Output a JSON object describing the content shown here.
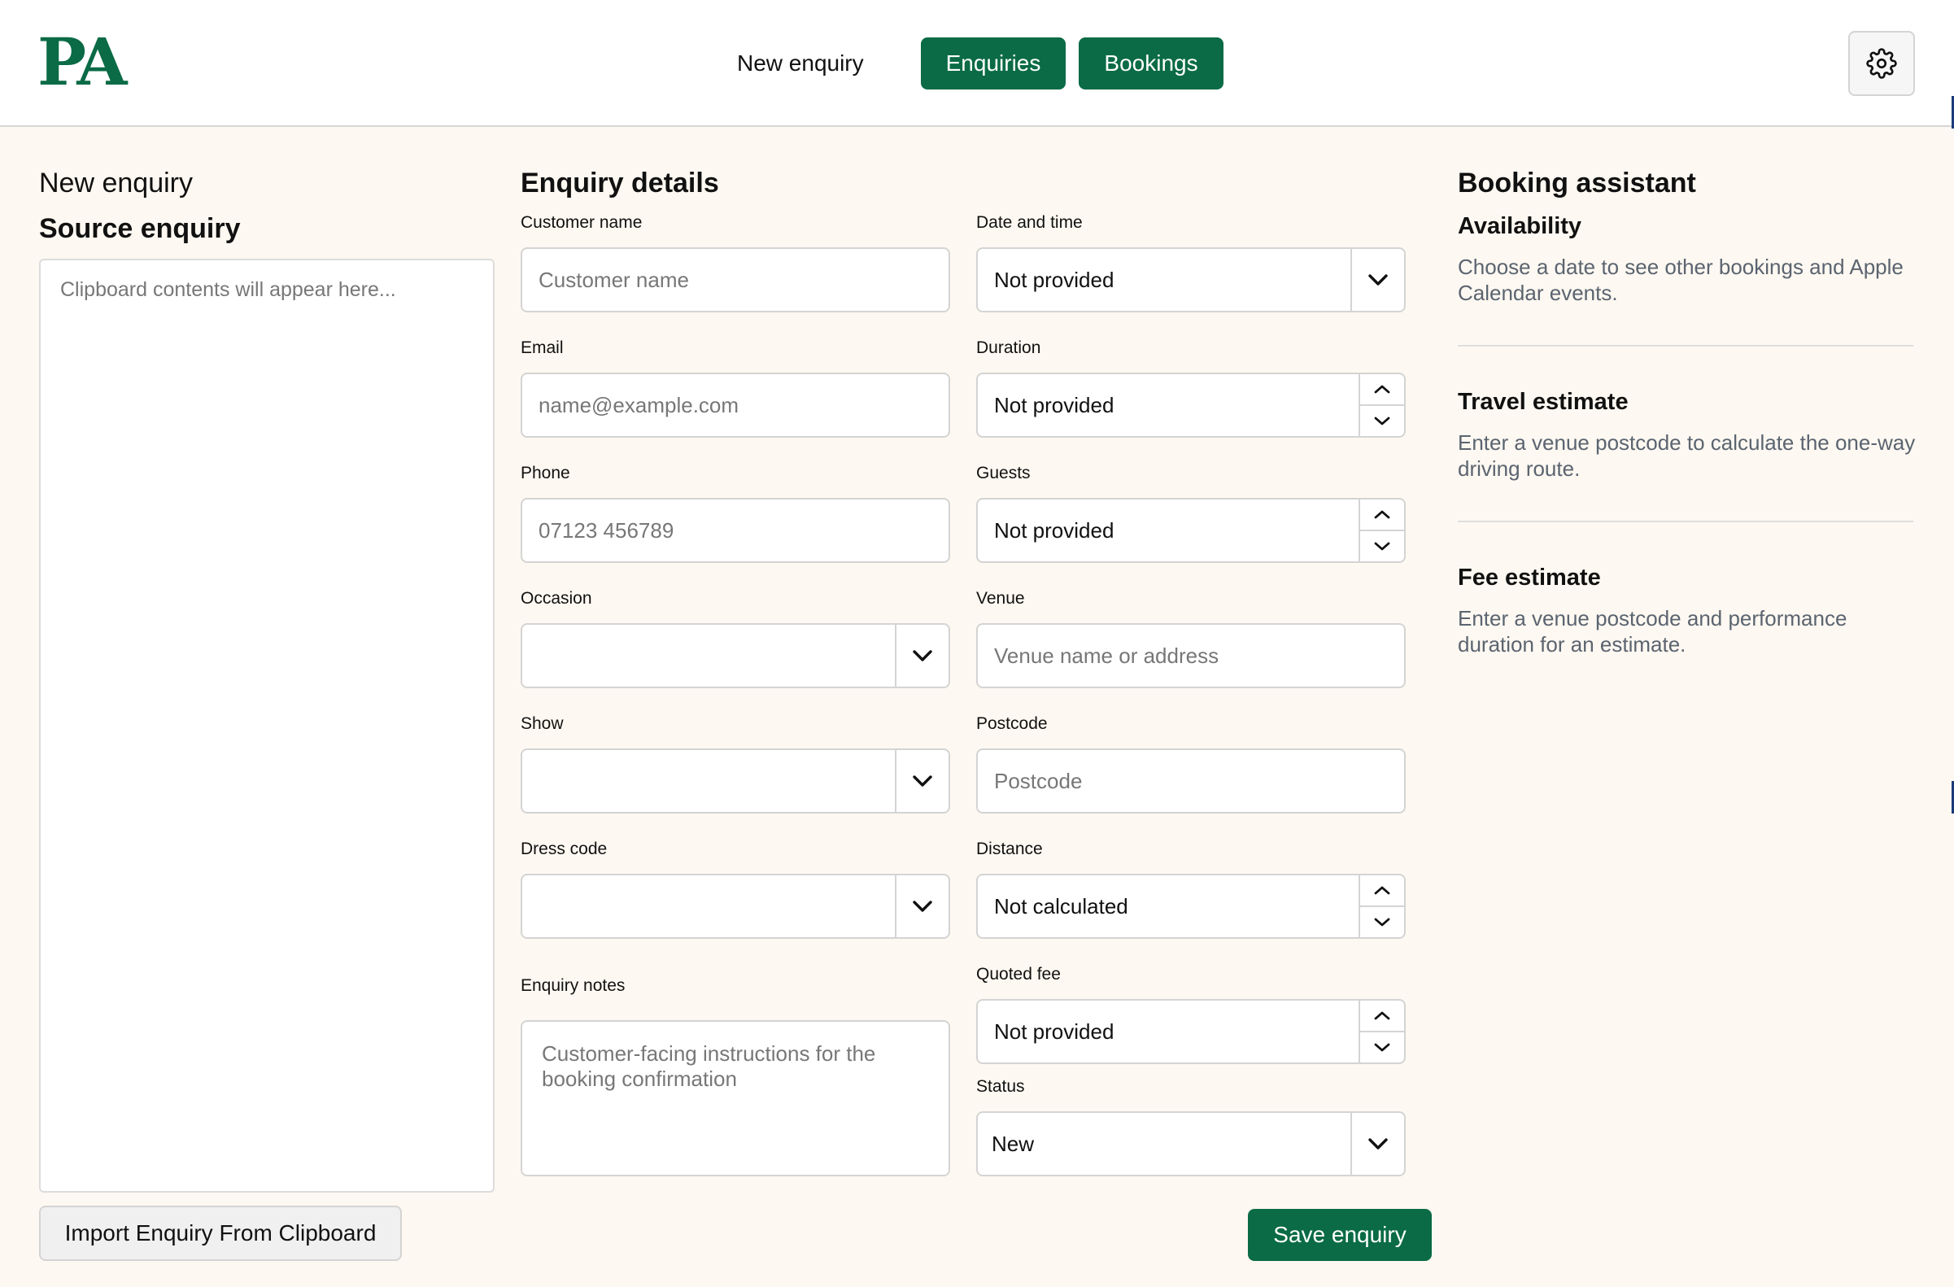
{
  "header": {
    "logo": "PA",
    "nav_new_enquiry": "New enquiry",
    "nav_enquiries": "Enquiries",
    "nav_bookings": "Bookings"
  },
  "left": {
    "subtitle": "New enquiry",
    "title": "Source enquiry",
    "clipboard_placeholder": "Clipboard contents will appear here...",
    "import_label": "Import Enquiry From Clipboard"
  },
  "form": {
    "title": "Enquiry details",
    "customer_name": {
      "label": "Customer name",
      "placeholder": "Customer name",
      "value": ""
    },
    "email": {
      "label": "Email",
      "placeholder": "name@example.com",
      "value": ""
    },
    "phone": {
      "label": "Phone",
      "placeholder": "07123 456789",
      "value": ""
    },
    "occasion": {
      "label": "Occasion",
      "value": ""
    },
    "show": {
      "label": "Show",
      "value": ""
    },
    "dress_code": {
      "label": "Dress code",
      "value": ""
    },
    "notes": {
      "label": "Enquiry notes",
      "placeholder": "Customer-facing instructions for the booking confirmation",
      "value": ""
    },
    "date_time": {
      "label": "Date and time",
      "value": "Not provided"
    },
    "duration": {
      "label": "Duration",
      "value": "Not provided"
    },
    "guests": {
      "label": "Guests",
      "value": "Not provided"
    },
    "venue": {
      "label": "Venue",
      "placeholder": "Venue name or address",
      "value": ""
    },
    "postcode": {
      "label": "Postcode",
      "placeholder": "Postcode",
      "value": ""
    },
    "distance": {
      "label": "Distance",
      "value": "Not calculated"
    },
    "quoted_fee": {
      "label": "Quoted fee",
      "value": "Not provided"
    },
    "status": {
      "label": "Status",
      "value": "New"
    },
    "save_label": "Save enquiry"
  },
  "assistant": {
    "title": "Booking assistant",
    "availability": {
      "heading": "Availability",
      "text": "Choose a date to see other bookings and Apple Calendar events."
    },
    "travel": {
      "heading": "Travel estimate",
      "text": "Enter a venue postcode to calculate the one-way driving route."
    },
    "fee": {
      "heading": "Fee estimate",
      "text": "Enter a venue postcode and performance duration for an estimate."
    }
  },
  "colors": {
    "brand": "#0a6b46",
    "background": "#fdf8f1",
    "muted_text": "#5b6470"
  },
  "icons": {
    "settings": "gear-icon",
    "select": "chevron-down-icon",
    "spin_up": "chevron-up-icon",
    "spin_down": "chevron-down-icon"
  }
}
